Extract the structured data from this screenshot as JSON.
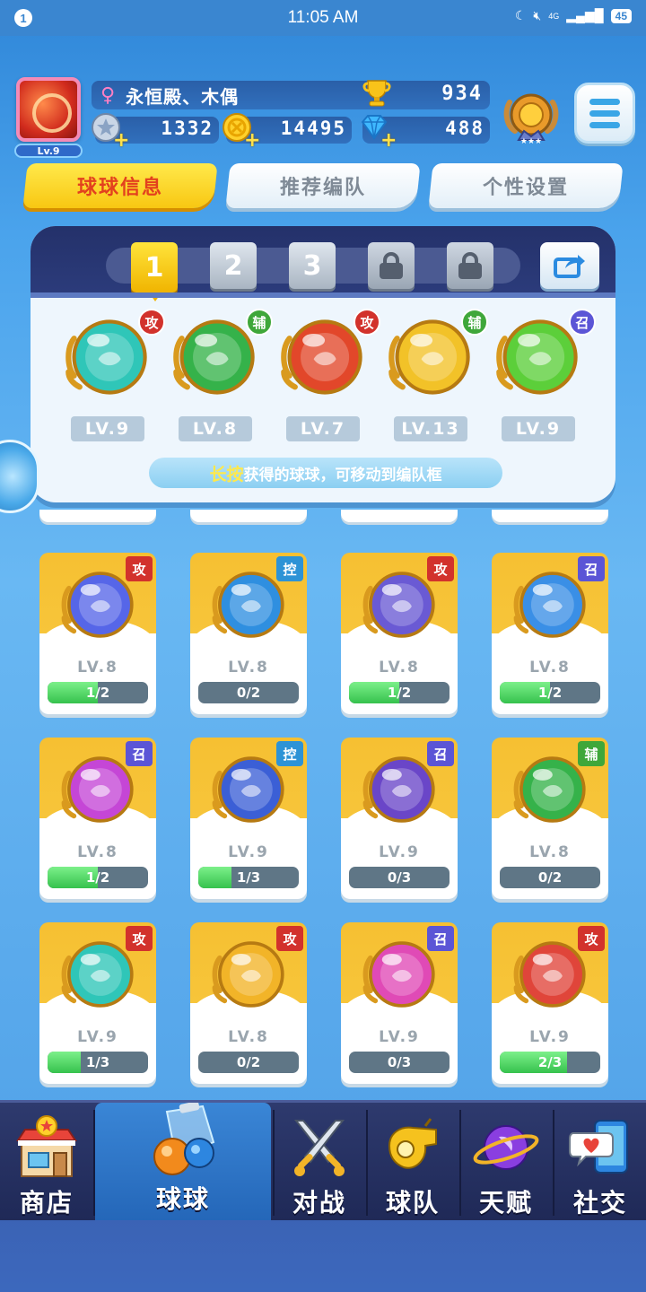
{
  "status_bar": {
    "notification_count": "1",
    "time": "11:05 AM",
    "network": "4G",
    "battery": "45"
  },
  "player": {
    "level": "Lv.9",
    "name": "永恒殿、木偶",
    "trophies": "934",
    "resource_1": "1332",
    "coins": "14495",
    "gems": "488"
  },
  "tabs": [
    {
      "label": "球球信息",
      "active": true
    },
    {
      "label": "推荐编队",
      "active": false
    },
    {
      "label": "个性设置",
      "active": false
    }
  ],
  "team": {
    "slots": [
      "1",
      "2",
      "3"
    ],
    "selected_slot": "1",
    "balls": [
      {
        "tag": "攻",
        "level": "LV.9",
        "color": "#2fc6b8"
      },
      {
        "tag": "辅",
        "level": "LV.8",
        "color": "#35b24a"
      },
      {
        "tag": "攻",
        "level": "LV.7",
        "color": "#e2472a"
      },
      {
        "tag": "辅",
        "level": "LV.13",
        "color": "#f2c228"
      },
      {
        "tag": "召",
        "level": "LV.9",
        "color": "#5ccf3a"
      }
    ],
    "hint_highlight": "长按",
    "hint_text": "获得的球球，可移动到编队框"
  },
  "collection": [
    {
      "tag": "攻",
      "level": "LV.8",
      "progress": "1/2",
      "fill": 0.5,
      "color": "#5666e8"
    },
    {
      "tag": "控",
      "level": "LV.8",
      "progress": "0/2",
      "fill": 0,
      "color": "#2f8fe0"
    },
    {
      "tag": "攻",
      "level": "LV.8",
      "progress": "1/2",
      "fill": 0.5,
      "color": "#6a5ad4"
    },
    {
      "tag": "召",
      "level": "LV.8",
      "progress": "1/2",
      "fill": 0.5,
      "color": "#3a8fe6"
    },
    {
      "tag": "召",
      "level": "LV.8",
      "progress": "1/2",
      "fill": 0.5,
      "color": "#c546d6"
    },
    {
      "tag": "控",
      "level": "LV.9",
      "progress": "1/3",
      "fill": 0.333,
      "color": "#3b5fd6"
    },
    {
      "tag": "召",
      "level": "LV.9",
      "progress": "0/3",
      "fill": 0,
      "color": "#6a46c8"
    },
    {
      "tag": "辅",
      "level": "LV.8",
      "progress": "0/2",
      "fill": 0,
      "color": "#35b24a"
    },
    {
      "tag": "攻",
      "level": "LV.9",
      "progress": "1/3",
      "fill": 0.333,
      "color": "#2fc6b8"
    },
    {
      "tag": "攻",
      "level": "LV.8",
      "progress": "0/2",
      "fill": 0,
      "color": "#f2b428"
    },
    {
      "tag": "召",
      "level": "LV.9",
      "progress": "0/3",
      "fill": 0,
      "color": "#e04ab6"
    },
    {
      "tag": "攻",
      "level": "LV.9",
      "progress": "2/3",
      "fill": 0.667,
      "color": "#e0453a"
    }
  ],
  "tag_colors": {
    "攻": "#d2322c",
    "辅": "#3fa73a",
    "召": "#5b55d6",
    "控": "#2d93d6"
  },
  "nav": [
    {
      "label": "商店",
      "icon": "shop-icon",
      "active": false
    },
    {
      "label": "球球",
      "icon": "balls-icon",
      "active": true
    },
    {
      "label": "对战",
      "icon": "swords-icon",
      "active": false
    },
    {
      "label": "球队",
      "icon": "whistle-icon",
      "active": false
    },
    {
      "label": "天赋",
      "icon": "planet-icon",
      "active": false
    },
    {
      "label": "社交",
      "icon": "chat-phone-icon",
      "active": false
    }
  ]
}
